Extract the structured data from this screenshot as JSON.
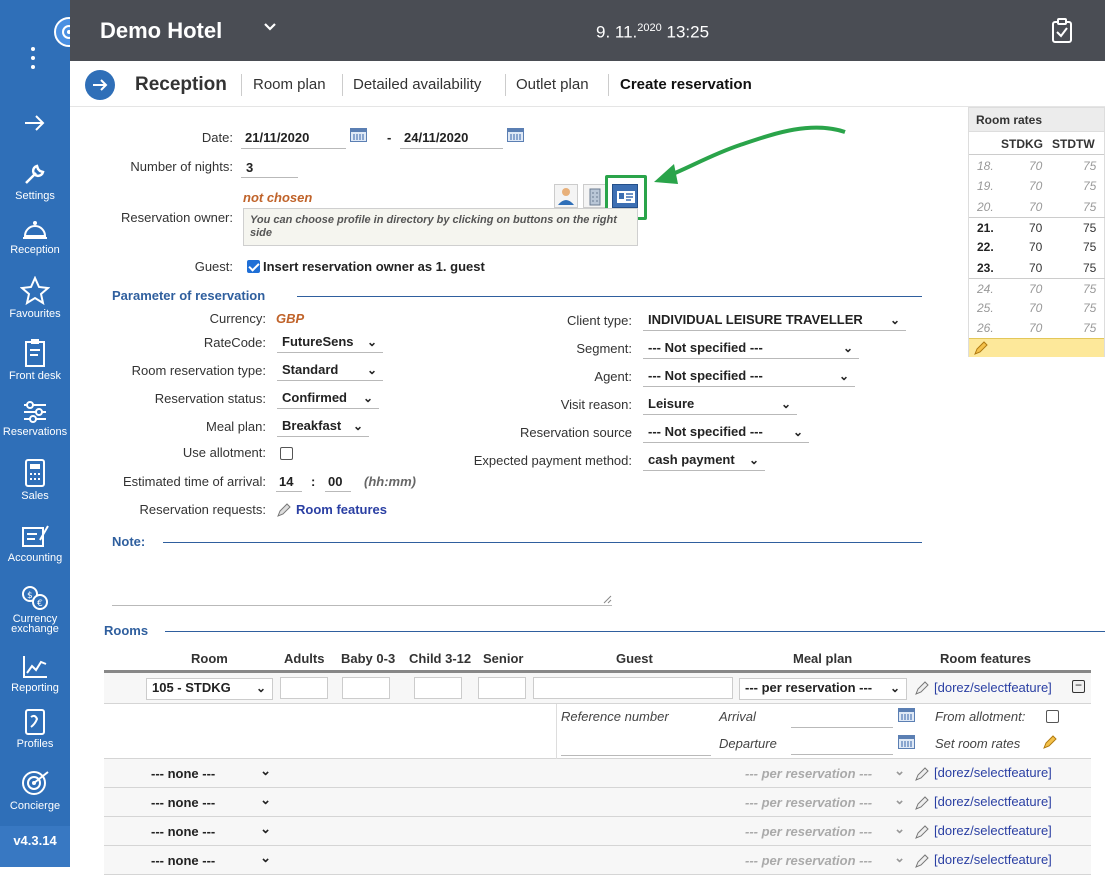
{
  "sidebar": {
    "items": [
      {
        "label": "Settings",
        "icon": "wrench-icon"
      },
      {
        "label": "Reception",
        "icon": "bell-icon"
      },
      {
        "label": "Favourites",
        "icon": "star-icon"
      },
      {
        "label": "Front desk",
        "icon": "clipboard-icon"
      },
      {
        "label": "Reservations",
        "icon": "sliders-icon"
      },
      {
        "label": "Sales",
        "icon": "calculator-icon"
      },
      {
        "label": "Accounting",
        "icon": "ledger-icon"
      },
      {
        "label": "Currency exchange",
        "icon": "currency-icon"
      },
      {
        "label": "Reporting",
        "icon": "chart-icon"
      },
      {
        "label": "Profiles",
        "icon": "address-book-icon"
      },
      {
        "label": "Concierge",
        "icon": "target-icon"
      }
    ],
    "version": "v4.3.14"
  },
  "header": {
    "hotel_name": "Demo Hotel",
    "date_day": "9. 11.",
    "date_year": "2020",
    "time": "13:25"
  },
  "nav": {
    "title": "Reception",
    "links": [
      "Room plan",
      "Detailed availability",
      "Outlet plan",
      "Create reservation"
    ]
  },
  "form": {
    "date_label": "Date:",
    "date_from": "21/11/2020",
    "date_sep": "-",
    "date_to": "24/11/2020",
    "nights_label": "Number of nights:",
    "nights": "3",
    "owner_label": "Reservation owner:",
    "owner_value": "not chosen",
    "owner_hint": "You can choose profile in directory by clicking on buttons on the right side",
    "guest_label": "Guest:",
    "guest_checkbox": "Insert reservation owner as 1. guest"
  },
  "params": {
    "section": "Parameter of reservation",
    "currency_label": "Currency:",
    "currency": "GBP",
    "ratecode_label": "RateCode:",
    "ratecode": "FutureSens",
    "roomtype_label": "Room reservation type:",
    "roomtype": "Standard",
    "status_label": "Reservation status:",
    "status": "Confirmed",
    "meal_label": "Meal plan:",
    "meal": "Breakfast",
    "allotment_label": "Use allotment:",
    "eta_label": "Estimated time of arrival:",
    "eta_h": "14",
    "eta_colon": ":",
    "eta_m": "00",
    "eta_hint": "(hh:mm)",
    "requests_label": "Reservation requests:",
    "requests_link": "Room features",
    "client_label": "Client type:",
    "client": "INDIVIDUAL LEISURE TRAVELLER",
    "segment_label": "Segment:",
    "segment": "--- Not specified ---",
    "agent_label": "Agent:",
    "agent": "--- Not specified ---",
    "visit_label": "Visit reason:",
    "visit": "Leisure",
    "source_label": "Reservation source",
    "source": "--- Not specified ---",
    "payment_label": "Expected payment method:",
    "payment": "cash payment"
  },
  "note": {
    "label": "Note:"
  },
  "rates": {
    "title": "Room rates",
    "cols": [
      "STDKG",
      "STDTW"
    ],
    "rows": [
      {
        "day": "18.",
        "a": "70",
        "b": "75",
        "style": "past"
      },
      {
        "day": "19.",
        "a": "70",
        "b": "75",
        "style": "past"
      },
      {
        "day": "20.",
        "a": "70",
        "b": "75",
        "style": "past"
      },
      {
        "day": "21.",
        "a": "70",
        "b": "75",
        "style": "sel"
      },
      {
        "day": "22.",
        "a": "70",
        "b": "75",
        "style": "sel"
      },
      {
        "day": "23.",
        "a": "70",
        "b": "75",
        "style": "sel"
      },
      {
        "day": "24.",
        "a": "70",
        "b": "75",
        "style": "past"
      },
      {
        "day": "25.",
        "a": "70",
        "b": "75",
        "style": "past"
      },
      {
        "day": "26.",
        "a": "70",
        "b": "75",
        "style": "past"
      }
    ]
  },
  "rooms": {
    "section": "Rooms",
    "headers": [
      "Room",
      "Adults",
      "Baby 0-3",
      "Child 3-12",
      "Senior",
      "Guest",
      "Meal plan",
      "Room features"
    ],
    "first_room": "105 - STDKG",
    "first_meal": "--- per reservation ---",
    "feature_link": "[dorez/selectfeature]",
    "ref_label": "Reference number",
    "arrival_label": "Arrival",
    "departure_label": "Departure",
    "from_allotment_label": "From allotment:",
    "set_rates_label": "Set room rates",
    "empty_rows": [
      {
        "room": "--- none ---",
        "meal": "--- per reservation ---",
        "link": "[dorez/selectfeature]"
      },
      {
        "room": "--- none ---",
        "meal": "--- per reservation ---",
        "link": "[dorez/selectfeature]"
      },
      {
        "room": "--- none ---",
        "meal": "--- per reservation ---",
        "link": "[dorez/selectfeature]"
      },
      {
        "room": "--- none ---",
        "meal": "--- per reservation ---",
        "link": "[dorez/selectfeature]"
      }
    ]
  },
  "colors": {
    "sidebar": "#2f6fb8",
    "topbar": "#4a4d54",
    "accent": "#2f5f9e",
    "highlight": "#2aa44a",
    "owner": "#c0632a"
  }
}
